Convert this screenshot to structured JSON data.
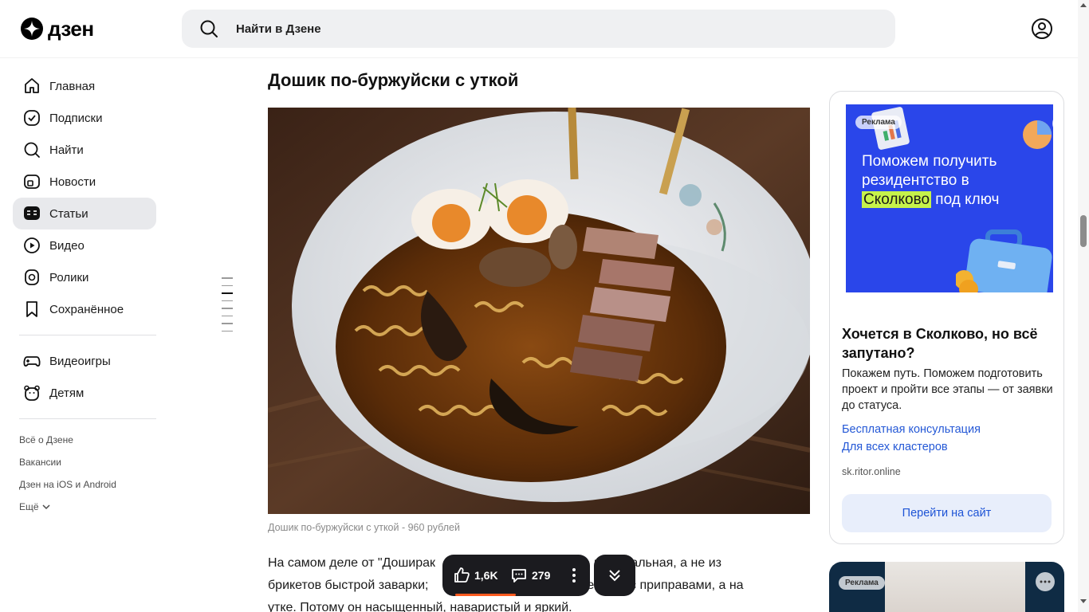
{
  "header": {
    "logo_text": "дзен",
    "search_placeholder": "Найти в Дзене"
  },
  "sidebar": {
    "items": [
      {
        "label": "Главная",
        "icon": "home-icon"
      },
      {
        "label": "Подписки",
        "icon": "subscriptions-icon"
      },
      {
        "label": "Найти",
        "icon": "search-icon"
      },
      {
        "label": "Новости",
        "icon": "news-icon"
      },
      {
        "label": "Статьи",
        "icon": "articles-icon",
        "active": true
      },
      {
        "label": "Видео",
        "icon": "video-icon"
      },
      {
        "label": "Ролики",
        "icon": "shorts-icon"
      },
      {
        "label": "Сохранённое",
        "icon": "bookmark-icon"
      }
    ],
    "extra_items": [
      {
        "label": "Видеоигры",
        "icon": "gamepad-icon"
      },
      {
        "label": "Детям",
        "icon": "kids-icon"
      }
    ],
    "footer_links": [
      "Всё о Дзене",
      "Вакансии",
      "Дзен на iOS и Android",
      "Ещё"
    ]
  },
  "article": {
    "title": "Дошик по-буржуйски с уткой",
    "image_caption": "Дошик по-буржуйски с уткой - 960 рублей",
    "body_line1_start": "На самом деле от \"Доширак",
    "body_line1_end": "премиальная, а не из",
    "body_line2_start": "брикетов быстрой заварки;",
    "body_line2_end": "етиков с приправами, а на",
    "body_line3": "утке. Потому он насыщенный, наваристый и яркий."
  },
  "actions": {
    "likes": "1,6K",
    "comments": "279"
  },
  "ad": {
    "badge": "Реклама",
    "banner_line1": "Поможем получить",
    "banner_line2": "резидентство в",
    "banner_highlight": "Сколково",
    "banner_line3_end": " под ключ",
    "title": "Хочется в Сколково, но всё запутано?",
    "description": "Покажем путь. Поможем подготовить проект и пройти все этапы — от заявки до статуса.",
    "link1": "Бесплатная консультация",
    "link2": "Для всех кластеров",
    "domain": "sk.ritor.online",
    "cta": "Перейти на сайт"
  },
  "ad2": {
    "badge": "Реклама"
  },
  "colors": {
    "accent_blue": "#2458d6",
    "ad_banner_blue": "#2a46ea",
    "highlight_green": "#c6f24a",
    "progress_orange": "#ff5a1f",
    "action_bar_bg": "#1b1b1f"
  }
}
